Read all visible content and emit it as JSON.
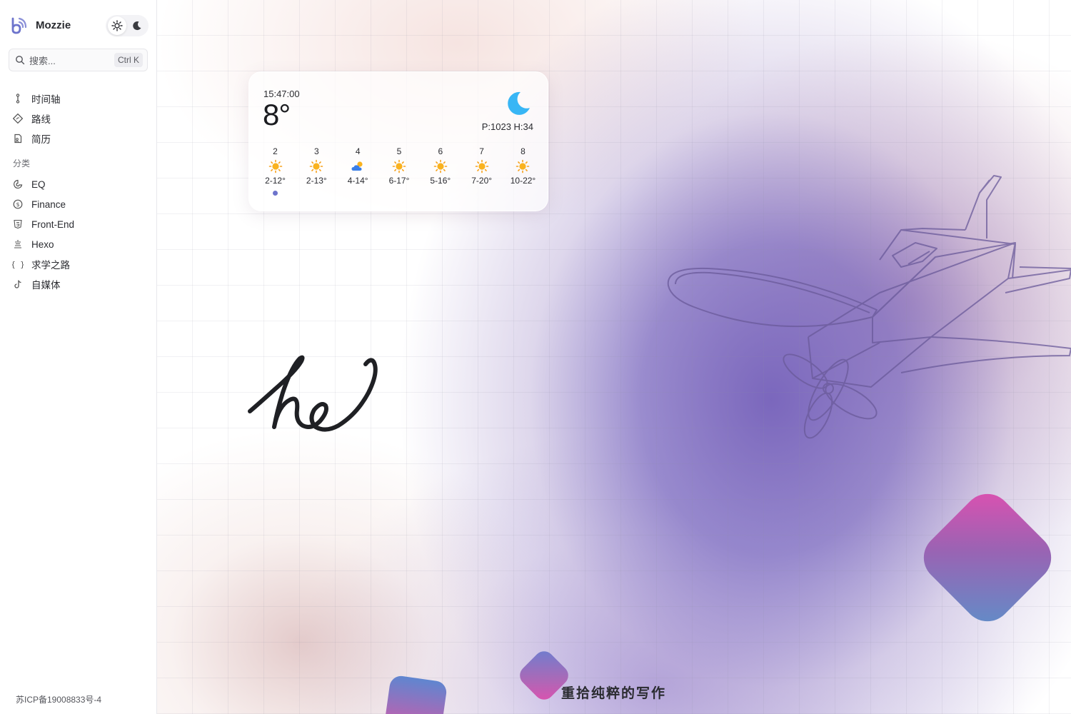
{
  "app": {
    "brand_name": "Mozzie",
    "theme_light_icon": "sun-icon",
    "theme_dark_icon": "moon-icon"
  },
  "search": {
    "placeholder": "搜索...",
    "shortcut": "Ctrl K"
  },
  "nav": {
    "primary": [
      {
        "label": "时间轴",
        "icon": "timeline-icon"
      },
      {
        "label": "路线",
        "icon": "route-icon"
      },
      {
        "label": "简历",
        "icon": "resume-icon"
      }
    ],
    "section_title": "分类",
    "categories": [
      {
        "label": "EQ",
        "icon": "brain-icon"
      },
      {
        "label": "Finance",
        "icon": "dollar-icon"
      },
      {
        "label": "Front-End",
        "icon": "html5-icon"
      },
      {
        "label": "Hexo",
        "icon": "hexo-icon"
      },
      {
        "label": "求学之路",
        "icon": "braces-icon"
      },
      {
        "label": "自媒体",
        "icon": "tiktok-icon"
      }
    ]
  },
  "footer": {
    "icp": "苏ICP备19008833号-4"
  },
  "weather": {
    "time": "15:47:00",
    "temperature": "8°",
    "current_icon": "crescent-moon-icon",
    "pressure_humidity": "P:1023 H:34",
    "forecast": [
      {
        "date": "2",
        "icon": "sun-icon",
        "range": "2-12°",
        "today": true
      },
      {
        "date": "3",
        "icon": "sun-icon",
        "range": "2-13°"
      },
      {
        "date": "4",
        "icon": "partly-cloudy-icon",
        "range": "4-14°"
      },
      {
        "date": "5",
        "icon": "sun-icon",
        "range": "6-17°"
      },
      {
        "date": "6",
        "icon": "sun-icon",
        "range": "5-16°"
      },
      {
        "date": "7",
        "icon": "sun-icon",
        "range": "7-20°"
      },
      {
        "date": "8",
        "icon": "sun-icon",
        "range": "10-22°"
      }
    ]
  },
  "hero": {
    "slogan": "重拾纯粹的写作",
    "handwriting": "he"
  },
  "colors": {
    "accent": "#6d74cc",
    "moon": "#38b6f5",
    "sun": "#f7a11a"
  }
}
